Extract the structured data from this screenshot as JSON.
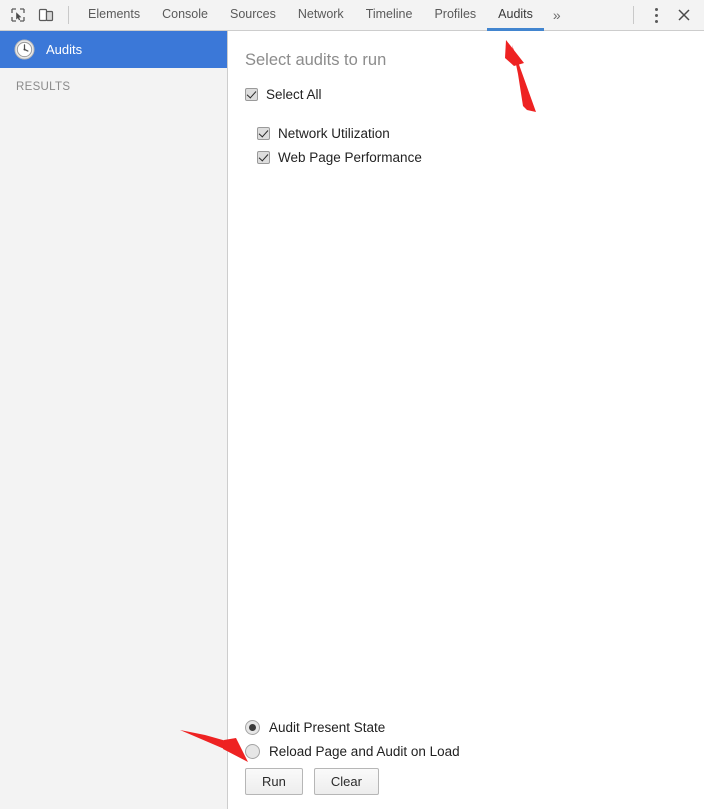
{
  "toolbar": {
    "inspect_icon": "inspect-cursor-icon",
    "device_icon": "device-toolbar-icon",
    "tabs": [
      {
        "label": "Elements",
        "active": false
      },
      {
        "label": "Console",
        "active": false
      },
      {
        "label": "Sources",
        "active": false
      },
      {
        "label": "Network",
        "active": false
      },
      {
        "label": "Timeline",
        "active": false
      },
      {
        "label": "Profiles",
        "active": false
      },
      {
        "label": "Audits",
        "active": true
      }
    ],
    "more_tabs_label": "»",
    "menu_icon": "kebab-menu-icon",
    "close_label": "✕",
    "active_underline_color": "#4285cf"
  },
  "sidebar": {
    "item": {
      "label": "Audits",
      "icon": "clock-gauge-icon",
      "selected": true,
      "selected_bg": "#3b78d8",
      "selected_text": "#ffffff"
    },
    "section_label": "RESULTS",
    "background": "#f3f3f3"
  },
  "main": {
    "title": "Select audits to run",
    "select_all": {
      "label": "Select All",
      "checked": true
    },
    "audits": [
      {
        "label": "Network Utilization",
        "checked": true
      },
      {
        "label": "Web Page Performance",
        "checked": true
      }
    ],
    "run_mode": [
      {
        "label": "Audit Present State",
        "selected": true
      },
      {
        "label": "Reload Page and Audit on Load",
        "selected": false
      }
    ],
    "buttons": {
      "run_label": "Run",
      "clear_label": "Clear"
    }
  },
  "annotations": {
    "arrow_color": "#ee2222",
    "arrows": [
      {
        "name": "arrow-to-audits-tab",
        "points_to": "Audits"
      },
      {
        "name": "arrow-to-run-button",
        "points_to": "Run"
      }
    ]
  }
}
